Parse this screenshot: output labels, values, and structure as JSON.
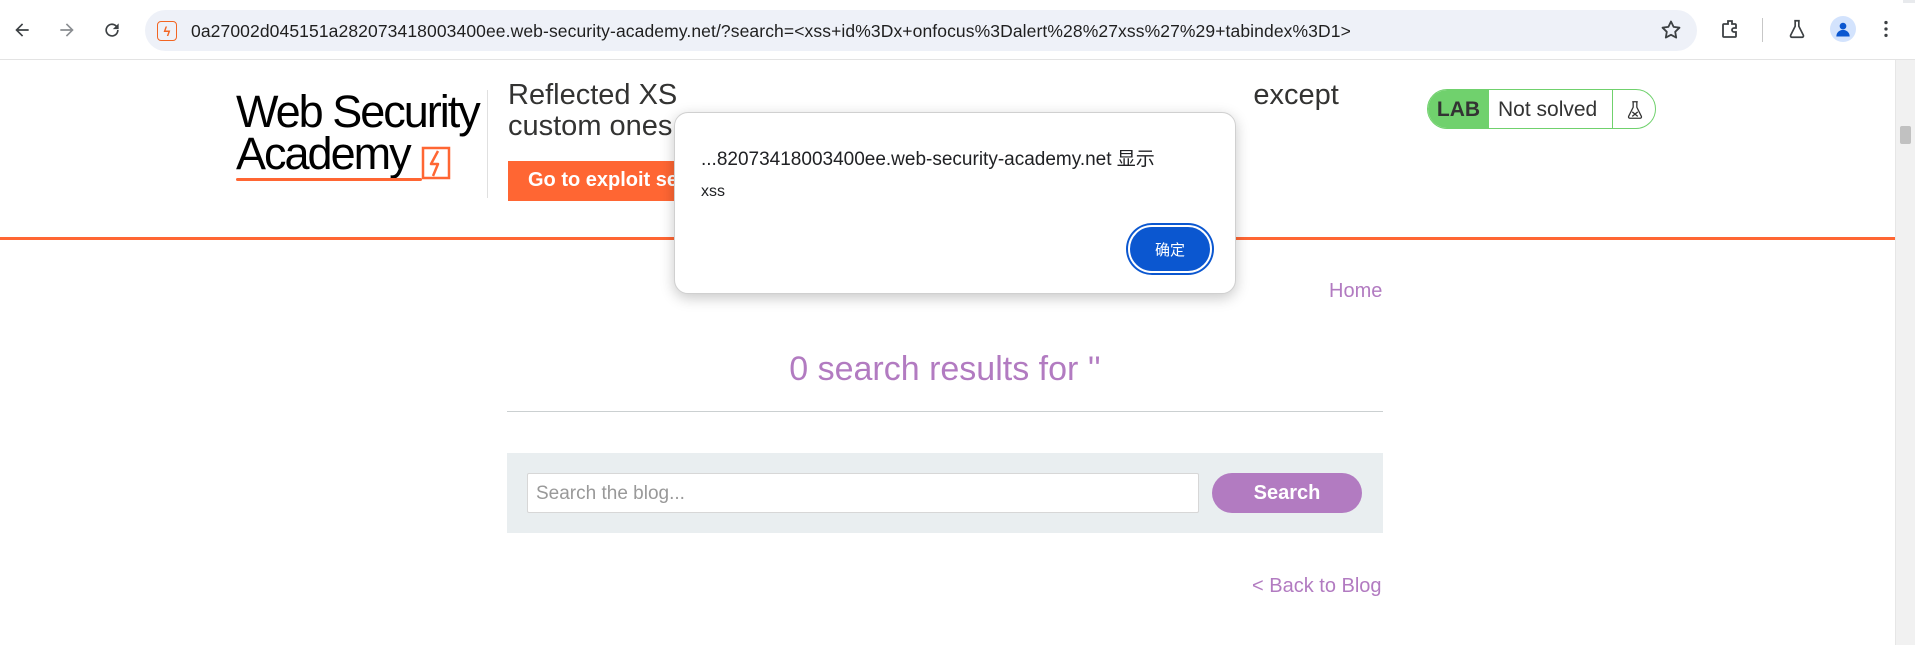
{
  "browser": {
    "url": "0a27002d045151a282073418003400ee.web-security-academy.net/?search=<xss+id%3Dx+onfocus%3Dalert%28%27xss%27%29+tabindex%3D1>",
    "icons": [
      "back-arrow-icon",
      "forward-arrow-icon",
      "reload-icon",
      "site-favicon-icon",
      "star-icon",
      "extensions-icon",
      "lab-flask-icon",
      "profile-icon",
      "more-menu-icon"
    ]
  },
  "header": {
    "logo_line1": "Web Security",
    "logo_line2": "Academy",
    "lab_title_start": "Reflected XS",
    "lab_title_end": "except",
    "lab_title_line2": "custom ones",
    "exploit_button": "Go to exploit server",
    "lab_badge": "LAB",
    "lab_status": "Not solved"
  },
  "main": {
    "home_link": "Home",
    "results_heading": "0 search results for ''",
    "search_placeholder": "Search the blog...",
    "search_button": "Search",
    "back_link": "< Back to Blog"
  },
  "dialog": {
    "title": "...82073418003400ee.web-security-academy.net 显示",
    "message": "xss",
    "ok_button": "确定"
  },
  "colors": {
    "accent_orange": "#ff6633",
    "link_purple": "#b27bc1",
    "lab_green": "#70d16d",
    "dialog_button_blue": "#0b57d0"
  }
}
